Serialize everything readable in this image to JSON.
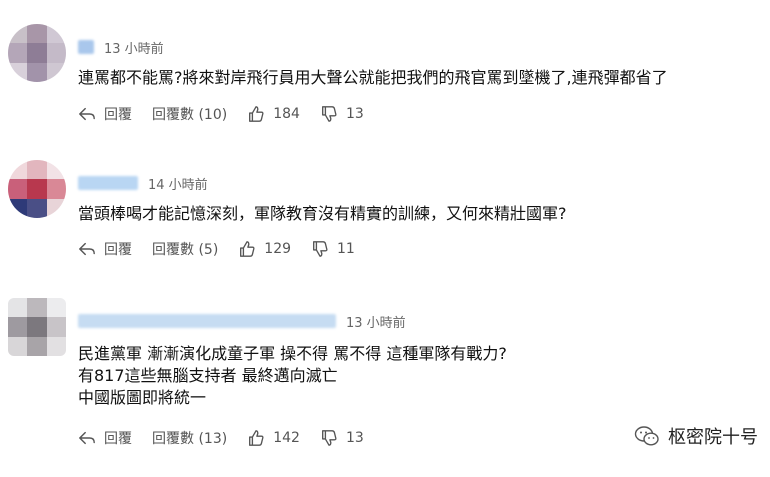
{
  "comments": [
    {
      "time": "13 小時前",
      "lines": [
        "連罵都不能罵?將來對岸飛行員用大聲公就能把我們的飛官罵到墜機了,連飛彈都省了"
      ],
      "reply_label": "回覆",
      "replies_label": "回覆數 (10)",
      "likes": "184",
      "dislikes": "13",
      "avatar_colors": [
        "#c8c0c8",
        "#a896a8",
        "#d0c8d4",
        "#b4a6b8",
        "#8e7d96",
        "#c4bac8",
        "#d8d0da",
        "#a293aa",
        "#cfc7d2"
      ],
      "name_color": "#a9c7ec"
    },
    {
      "time": "14 小時前",
      "lines": [
        "當頭棒喝才能記憶深刻，軍隊教育沒有精實的訓練，又何來精壯國軍?"
      ],
      "reply_label": "回覆",
      "replies_label": "回覆數 (5)",
      "likes": "129",
      "dislikes": "11",
      "avatar_colors": [
        "#f0d8dc",
        "#e2b6be",
        "#f2e2e6",
        "#c9607a",
        "#b8384e",
        "#d98896",
        "#2e3a78",
        "#4a4f86",
        "#e8d4d8"
      ],
      "name_color": "#b9d6f3"
    },
    {
      "time": "13 小時前",
      "lines": [
        "民進黨軍 漸漸演化成童子軍 操不得 罵不得 這種軍隊有戰力?",
        "有817這些無腦支持者 最終邁向滅亡",
        "中國版圖即將統一"
      ],
      "reply_label": "回覆",
      "replies_label": "回覆數 (13)",
      "likes": "142",
      "dislikes": "13",
      "avatar_colors": [
        "#e4e4e6",
        "#bcb8bc",
        "#ececee",
        "#9e9aa0",
        "#7c787e",
        "#c8c4c8",
        "#d8d6d8",
        "#a8a4a8",
        "#e2e0e2"
      ],
      "name_color": "#c6dcf2"
    }
  ],
  "watermark": {
    "text": "枢密院十号",
    "icon": "wechat-icon"
  }
}
